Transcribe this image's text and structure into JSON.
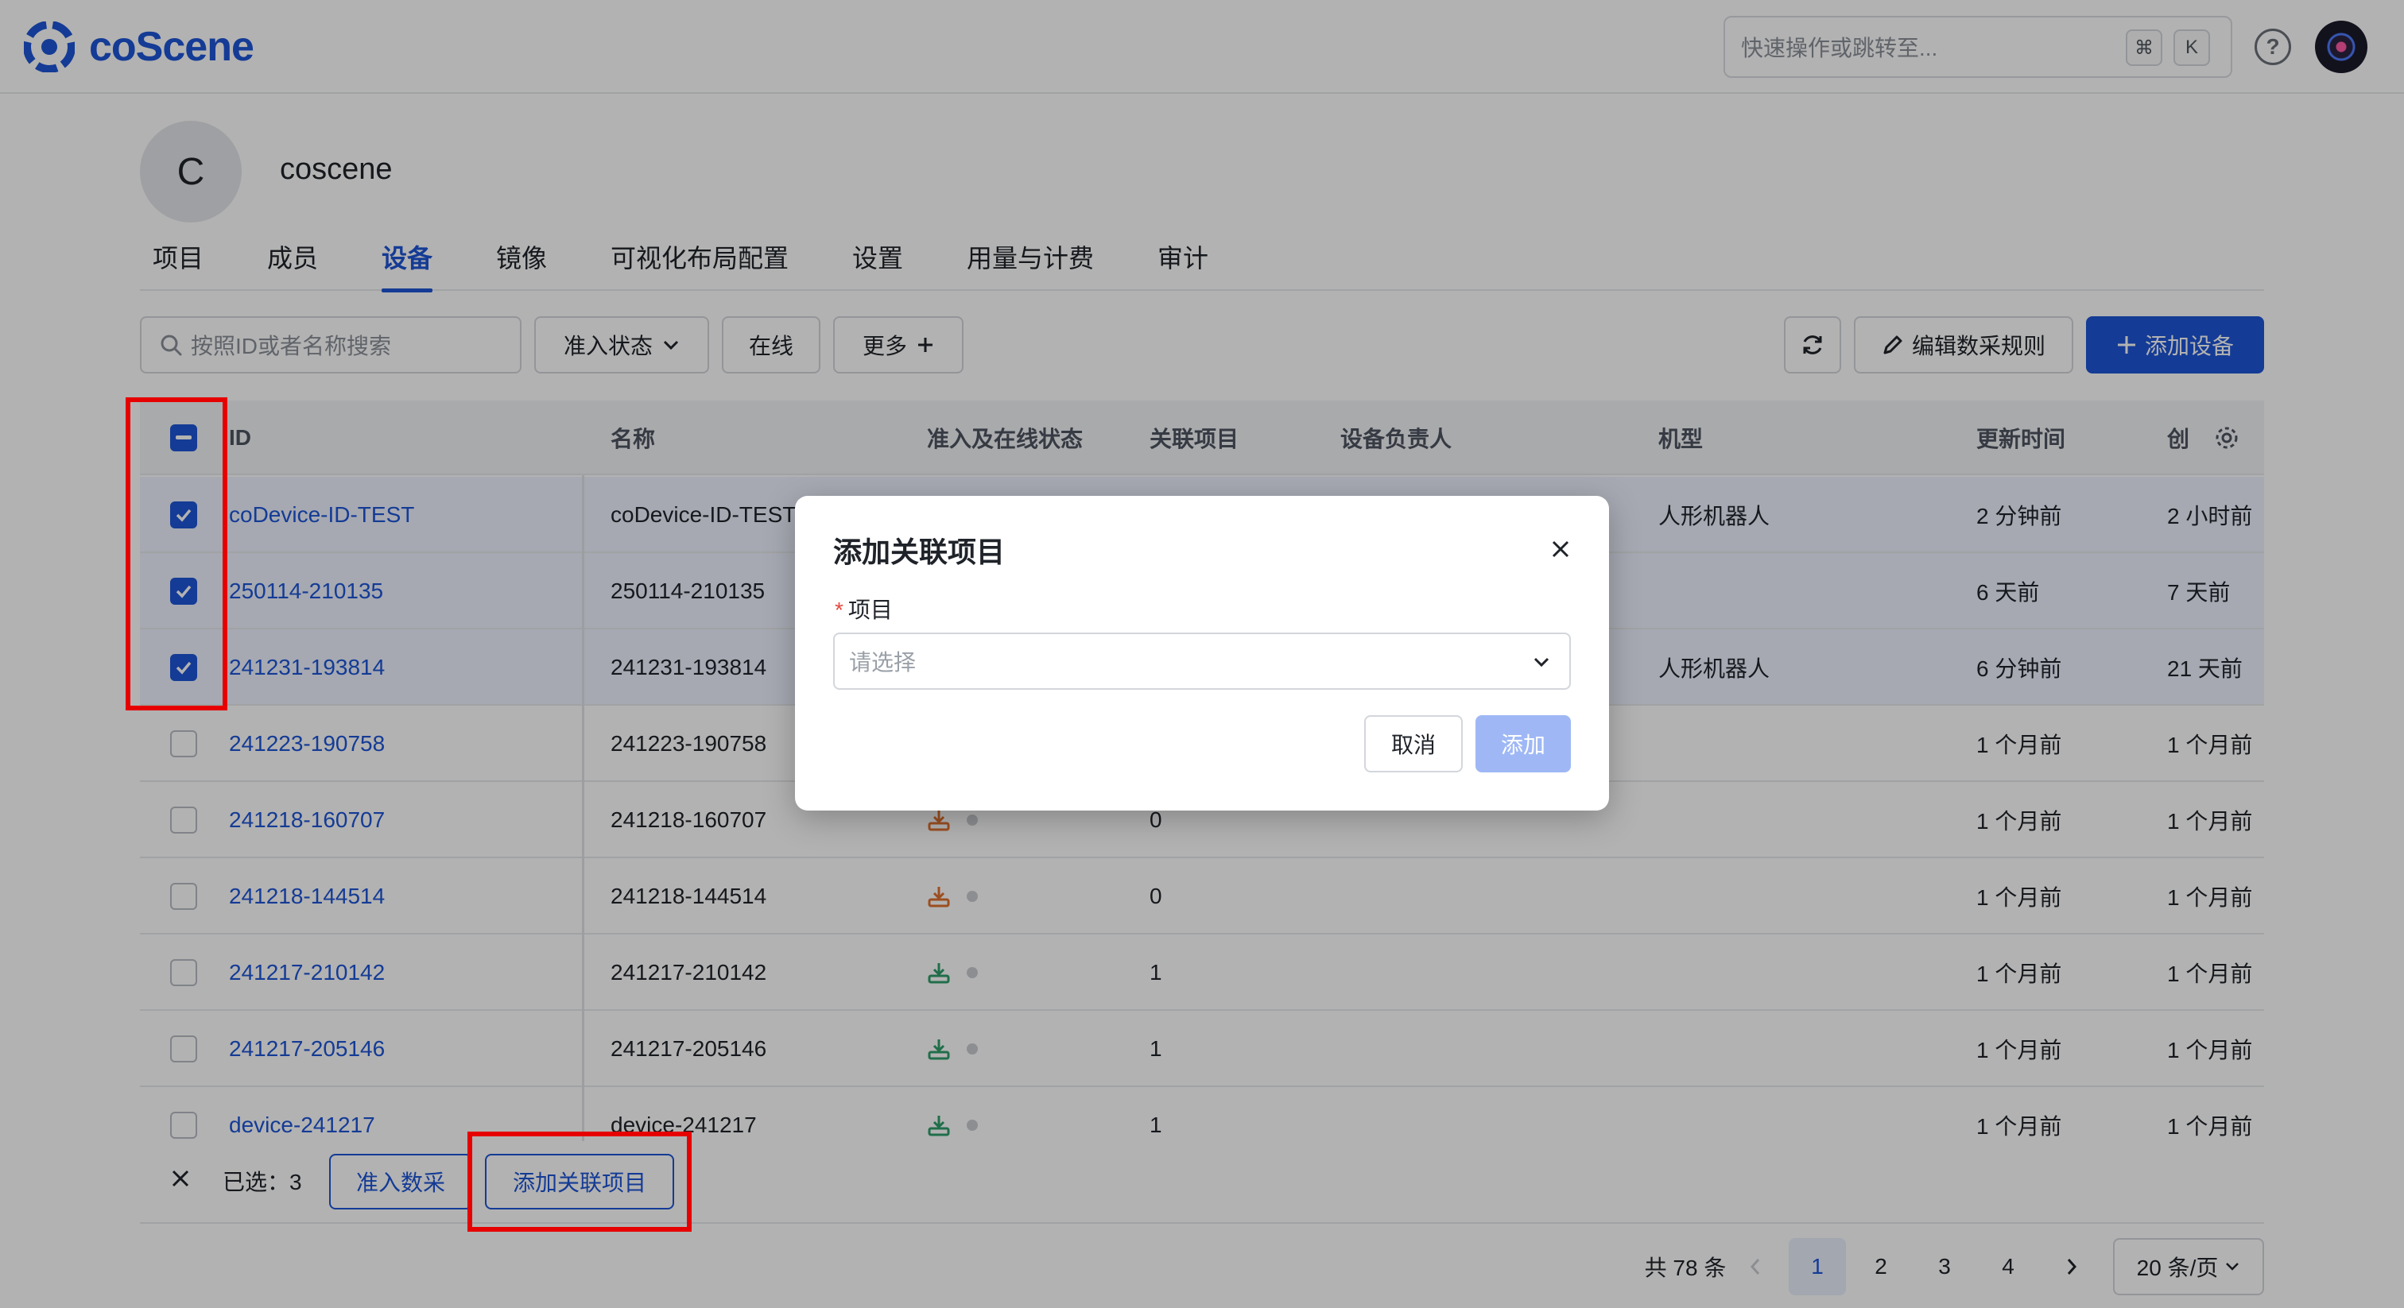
{
  "app": {
    "brand": "coScene",
    "command_search_placeholder": "快速操作或跳转至...",
    "shortcut_cmd": "⌘",
    "shortcut_k": "K",
    "help": "?"
  },
  "org": {
    "initial": "C",
    "name": "coscene"
  },
  "tabs": [
    {
      "label": "项目"
    },
    {
      "label": "成员"
    },
    {
      "label": "设备"
    },
    {
      "label": "镜像"
    },
    {
      "label": "可视化布局配置"
    },
    {
      "label": "设置"
    },
    {
      "label": "用量与计费"
    },
    {
      "label": "审计"
    }
  ],
  "active_tab": "设备",
  "toolbar": {
    "search_placeholder": "按照ID或者名称搜索",
    "filter_status": "准入状态",
    "filter_online": "在线",
    "more": "更多",
    "edit_rules": "编辑数采规则",
    "add_device": "添加设备"
  },
  "table": {
    "columns": [
      "ID",
      "名称",
      "准入及在线状态",
      "关联项目",
      "设备负责人",
      "机型",
      "更新时间",
      "创"
    ],
    "rows": [
      {
        "id": "coDevice-ID-TEST",
        "name": "coDevice-ID-TEST",
        "projects": "",
        "model": "人形机器人",
        "updated": "2 分钟前",
        "created": "2 小时前",
        "selected": true,
        "access": "",
        "access_color": ""
      },
      {
        "id": "250114-210135",
        "name": "250114-210135",
        "projects": "",
        "model": "",
        "updated": "6 天前",
        "created": "7 天前",
        "selected": true,
        "access": "",
        "access_color": ""
      },
      {
        "id": "241231-193814",
        "name": "241231-193814",
        "projects": "",
        "model": "人形机器人",
        "updated": "6 分钟前",
        "created": "21 天前",
        "selected": true,
        "access": "",
        "access_color": ""
      },
      {
        "id": "241223-190758",
        "name": "241223-190758",
        "projects": "",
        "model": "",
        "updated": "1 个月前",
        "created": "1 个月前",
        "selected": false,
        "access": "",
        "access_color": ""
      },
      {
        "id": "241218-160707",
        "name": "241218-160707",
        "projects": "0",
        "model": "",
        "updated": "1 个月前",
        "created": "1 个月前",
        "selected": false,
        "access": "pending",
        "access_color": "#e0702f"
      },
      {
        "id": "241218-144514",
        "name": "241218-144514",
        "projects": "0",
        "model": "",
        "updated": "1 个月前",
        "created": "1 个月前",
        "selected": false,
        "access": "pending",
        "access_color": "#e0702f"
      },
      {
        "id": "241217-210142",
        "name": "241217-210142",
        "projects": "1",
        "model": "",
        "updated": "1 个月前",
        "created": "1 个月前",
        "selected": false,
        "access": "approved",
        "access_color": "#2f9e6a"
      },
      {
        "id": "241217-205146",
        "name": "241217-205146",
        "projects": "1",
        "model": "",
        "updated": "1 个月前",
        "created": "1 个月前",
        "selected": false,
        "access": "approved",
        "access_color": "#2f9e6a"
      },
      {
        "id": "device-241217",
        "name": "device-241217",
        "projects": "1",
        "model": "",
        "updated": "1 个月前",
        "created": "1 个月前",
        "selected": false,
        "access": "approved",
        "access_color": "#2f9e6a"
      }
    ]
  },
  "selection_bar": {
    "selected_label": "已选：",
    "selected_count": "3",
    "allow_collect": "准入数采",
    "add_project": "添加关联项目"
  },
  "pagination": {
    "total": "共 78 条",
    "pages": [
      "1",
      "2",
      "3",
      "4"
    ],
    "current": "1",
    "page_size": "20 条/页"
  },
  "modal": {
    "title": "添加关联项目",
    "field_label": "项目",
    "required_mark": "*",
    "select_placeholder": "请选择",
    "cancel": "取消",
    "add": "添加"
  },
  "colors": {
    "primary": "#1d55d6",
    "selected_row": "#eef3ff",
    "annotation_red": "#e60000",
    "add_disabled": "#9fb8f5"
  }
}
